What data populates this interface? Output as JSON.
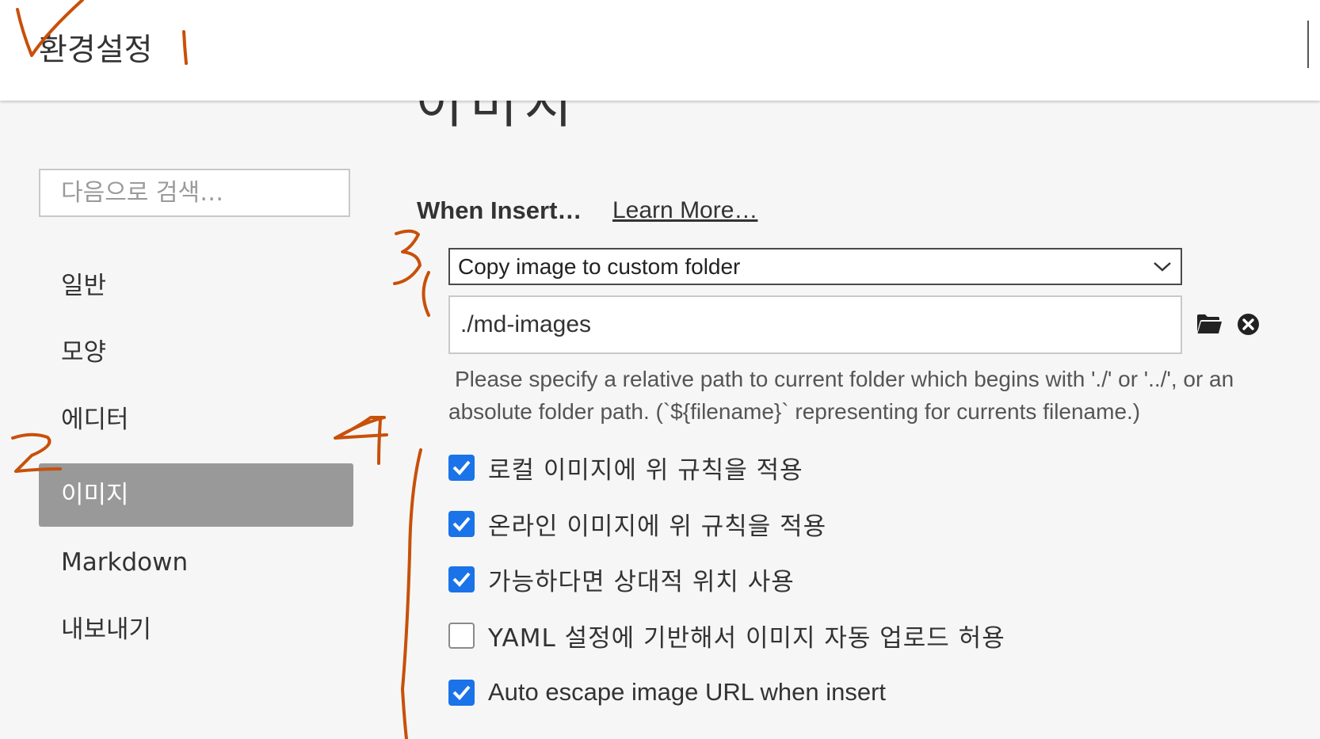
{
  "window": {
    "title": "환경설정"
  },
  "main": {
    "heading": "이미지",
    "when_insert_label": "When Insert…",
    "learn_more": "Learn More…",
    "insert_action": "Copy image to custom folder",
    "image_folder": "./md-images",
    "help_text": "Please specify a relative path to current folder which begins with './' or '../', or an absolute folder path. (`${filename}` representing for currents filename.)",
    "options": [
      {
        "label": "로컬 이미지에 위 규칙을 적용",
        "checked": true
      },
      {
        "label": "온라인 이미지에 위 규칙을 적용",
        "checked": true
      },
      {
        "label": "가능하다면 상대적 위치 사용",
        "checked": true
      },
      {
        "label": "YAML 설정에 기반해서 이미지 자동 업로드 허용",
        "checked": false
      },
      {
        "label": "Auto escape image URL when insert",
        "checked": true
      }
    ]
  },
  "sidebar": {
    "search_placeholder": "다음으로 검색…",
    "items": [
      {
        "label": "일반",
        "active": false
      },
      {
        "label": "모양",
        "active": false
      },
      {
        "label": "에디터",
        "active": false
      },
      {
        "label": "이미지",
        "active": true
      },
      {
        "label": "Markdown",
        "active": false
      },
      {
        "label": "내보내기",
        "active": false
      }
    ]
  },
  "icons": {
    "dropdown": "chevron-down-icon",
    "folder": "folder-icon",
    "clear": "clear-icon",
    "check": "checkmark-icon"
  },
  "colors": {
    "accent": "#1a73e8",
    "sidebar_active_bg": "#999999",
    "annotation": "#c8500a"
  },
  "annotations": [
    "3",
    "2",
    "4"
  ]
}
